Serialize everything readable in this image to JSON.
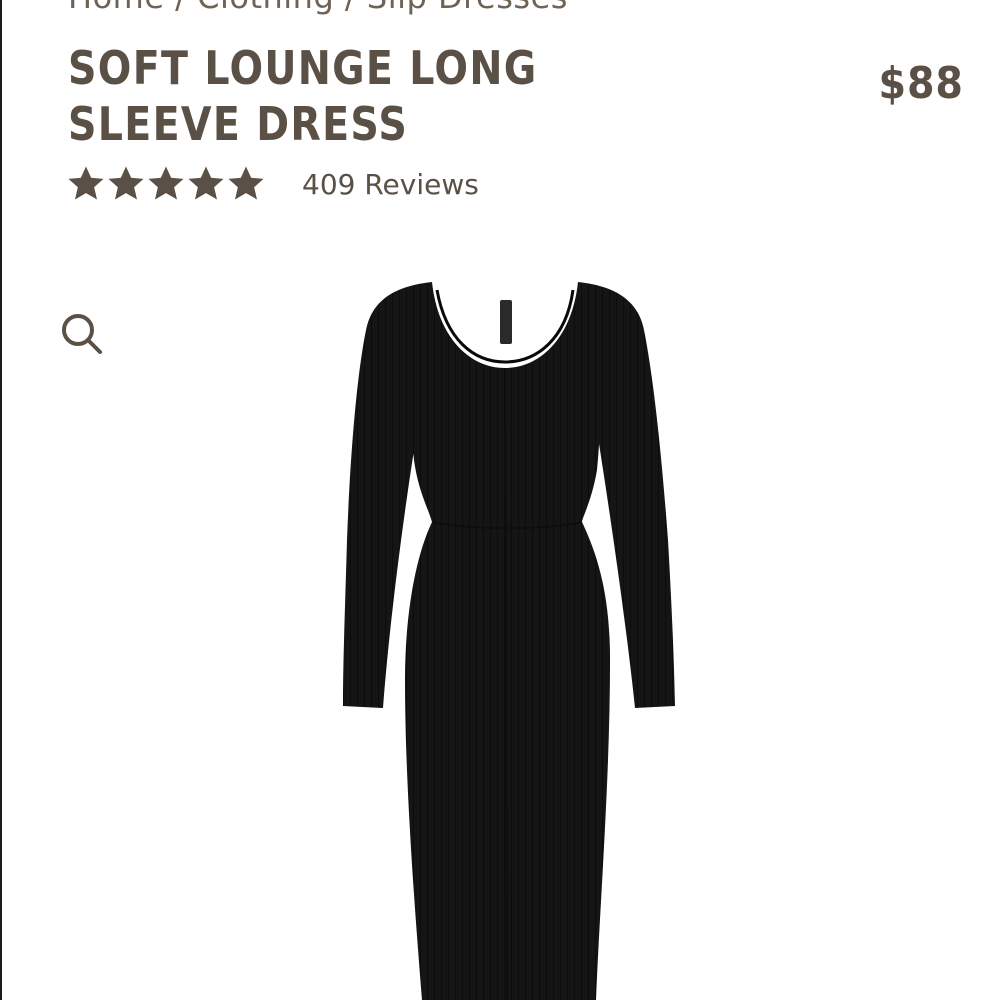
{
  "breadcrumb": {
    "text": "Home / Clothing / Slip Dresses"
  },
  "product": {
    "title_line1": "SOFT LOUNGE LONG",
    "title_line2": "SLEEVE DRESS",
    "price": "$88",
    "rating": 5,
    "rating_max": 5,
    "reviews_label": "409 Reviews"
  },
  "icons": {
    "star": "star-icon",
    "zoom": "search-icon"
  },
  "colors": {
    "text_brown": "#5b5046",
    "star_color": "#5b5046",
    "dress_black": "#141414",
    "background": "#ffffff"
  }
}
